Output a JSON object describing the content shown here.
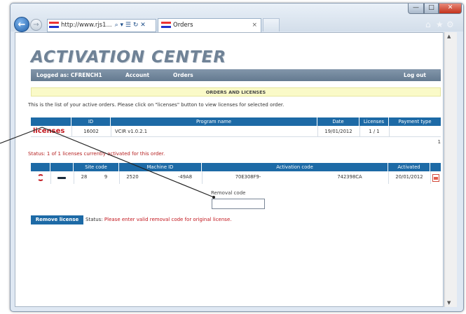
{
  "browser": {
    "address": "http://www.rjs1...",
    "address_icons": "⌕ ▾ ☰ ↻ ✕",
    "tab_title": "Orders",
    "tab_close": "×",
    "back": "←",
    "forward": "→",
    "minimize": "—",
    "maximize": "□",
    "close": "✕",
    "home_icon": "⌂",
    "favorites_icon": "★",
    "tools_icon": "⚙"
  },
  "page": {
    "logo": "ACTIVATION CENTER",
    "nav": {
      "logged_as": "Logged as: CFRENCH1",
      "account": "Account",
      "orders": "Orders",
      "logout": "Log out"
    },
    "section_title": "ORDERS AND LICENSES",
    "info_text": "This is the list of your active orders. Please click on \"licenses\" button to view licenses for selected order.",
    "orders_table": {
      "headers": [
        "ID",
        "Program name",
        "Date",
        "Licenses",
        "Payment type"
      ],
      "rows": [
        {
          "action": "licenses",
          "id": "16002",
          "program": "VCIR v1.0.2.1",
          "date": "19/01/2012",
          "licenses": "1 / 1",
          "payment": ""
        }
      ],
      "pager": "1"
    },
    "license_status": "Status: 1 of 1 licenses currently activated for this order.",
    "licenses_table": {
      "headers": [
        "Site code",
        "Machine ID",
        "Activation code",
        "Activated"
      ],
      "rows": [
        {
          "site_code_a": "28",
          "site_code_b": "9",
          "machine_id_a": "2520",
          "machine_id_b": "-49A8",
          "activation_a": "70E308F9-",
          "activation_b": "742398CA",
          "activated": "20/01/2012"
        }
      ]
    },
    "removal_code_label": "Removal code",
    "removal_code_value": "",
    "remove_button": "Remove license",
    "status_label": "Status:",
    "status_message": "Please enter valid removal code for original license."
  }
}
